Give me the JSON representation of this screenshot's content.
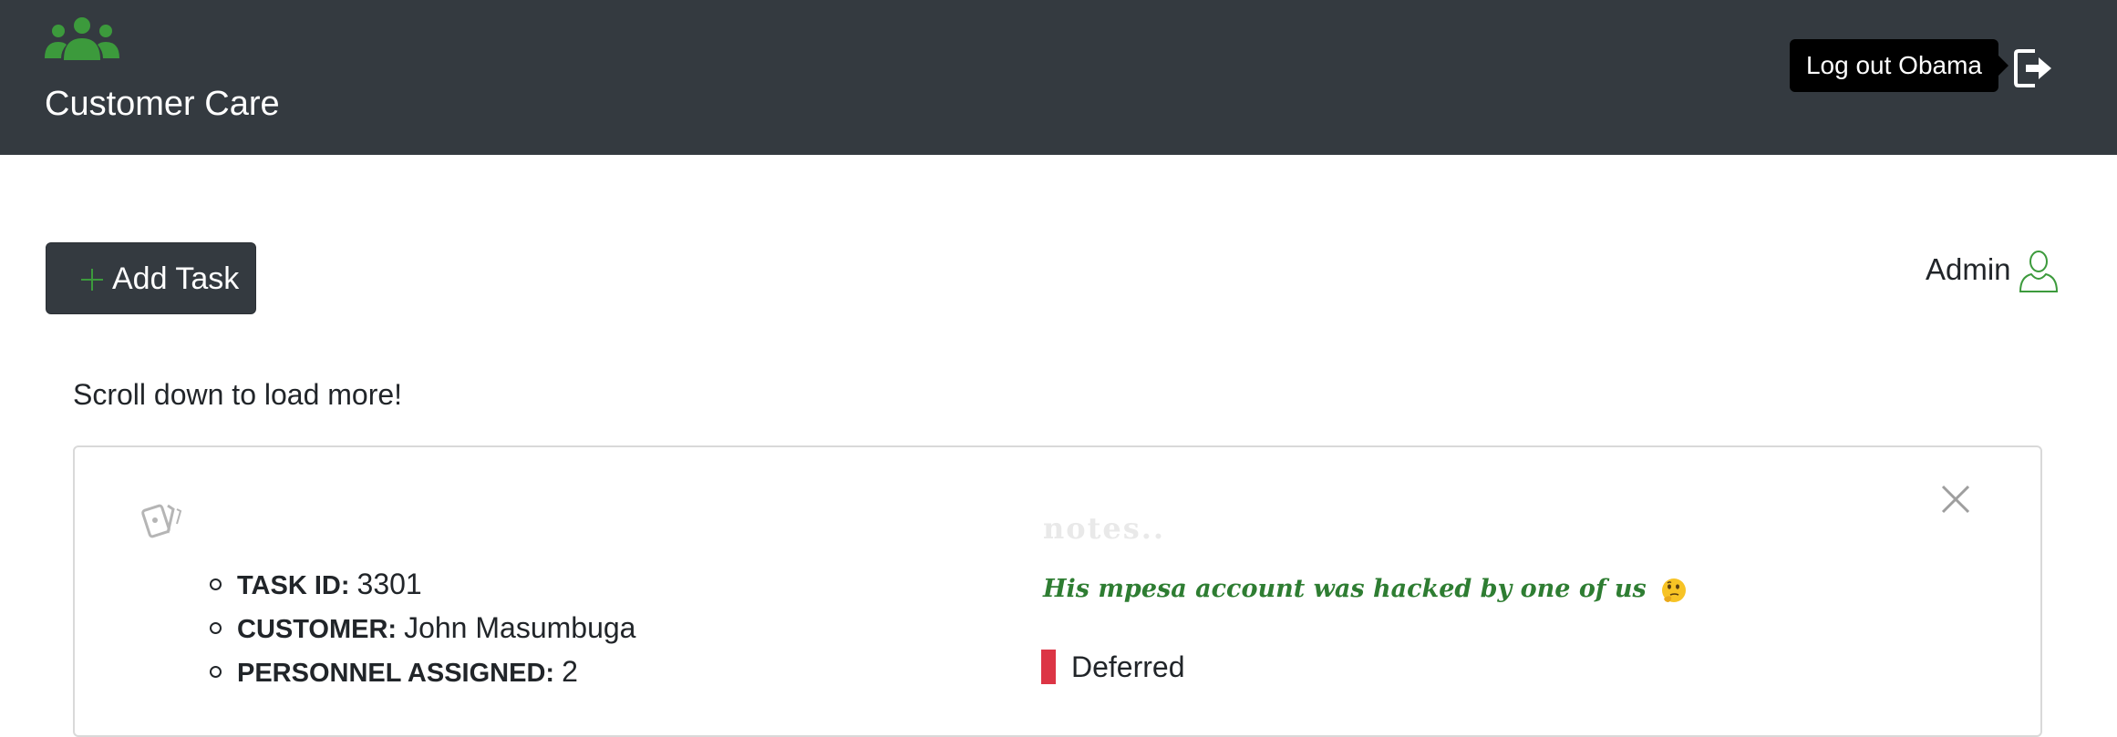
{
  "header": {
    "brand_icon": "users-group-icon",
    "title": "Customer Care",
    "logout_tooltip": "Log out Obama",
    "logout_icon": "logout-icon"
  },
  "toolbar": {
    "add_task_label": "Add Task",
    "add_icon": "plus-icon",
    "role_label": "Admin",
    "role_icon": "user-outline-icon"
  },
  "hint": "Scroll down to load more!",
  "task": {
    "icon": "cards-icon",
    "fields": [
      {
        "label": "TASK ID:",
        "value": "3301"
      },
      {
        "label": "CUSTOMER:",
        "value": "John Masumbuga"
      },
      {
        "label": "PERSONNEL ASSIGNED:",
        "value": "2"
      }
    ],
    "notes_placeholder": "notes..",
    "notes": "His mpesa account was hacked by one of us",
    "notes_emoji": "thinking-face-icon",
    "status": "Deferred",
    "status_color": "#dc3545",
    "close_icon": "close-icon"
  },
  "colors": {
    "navbar": "#343a40",
    "accent_green": "#3c9a3c",
    "notes_green": "#2e7d32"
  }
}
